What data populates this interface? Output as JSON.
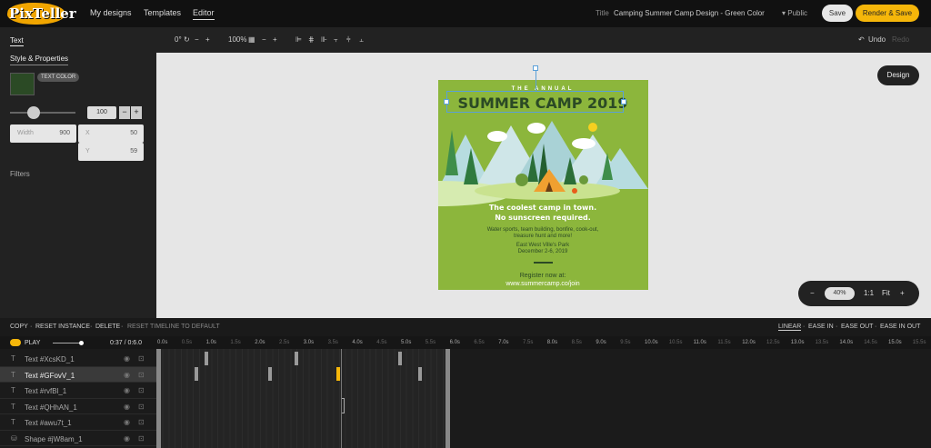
{
  "app": {
    "logo": "PixTeller",
    "nav": [
      "My designs",
      "Templates",
      "Editor"
    ]
  },
  "header": {
    "title_label": "Title",
    "title_value": "Camping Summer Camp Design - Green Color",
    "visibility": "▾ Public",
    "save": "Save",
    "render": "Render & Save"
  },
  "left": {
    "tab_text": "Text",
    "style_tab": "Style & Properties",
    "text_color_label": "TEXT COLOR",
    "text_color": "#2b4a25",
    "opacity_value": "100",
    "width_label": "Width",
    "width_value": "900",
    "x_label": "X",
    "x_value": "50",
    "y_label": "Y",
    "y_value": "59",
    "filters": "Filters"
  },
  "toolbar": {
    "rotation": "0°",
    "zoom_pct": "100%",
    "undo": "Undo",
    "redo": "Redo"
  },
  "canvas": {
    "design_btn": "Design",
    "zoom": "40%",
    "ratio": "1:1",
    "fit": "Fit",
    "poster_bg": "#8cb63c",
    "poster": {
      "kicker": "THE ANNUAL",
      "headline": "SUMMER CAMP 2019",
      "tag1": "The coolest camp in town.",
      "tag2": "No sunscreen required.",
      "desc1": "Water sports, team building, bonfire, cook-out,",
      "desc2": "treasure hunt and more!",
      "loc": "East West Ville's Park",
      "dates": "December 2-6, 2019",
      "reg": "Register now at:",
      "url": "www.summercamp.co/join"
    }
  },
  "actions": {
    "left": [
      "COPY",
      "·",
      "RESET INSTANCE",
      "·",
      "DELETE",
      "·",
      "RESET TIMELINE TO DEFAULT"
    ],
    "easing": [
      "LINEAR",
      "·",
      "EASE IN",
      "·",
      "EASE OUT",
      "·",
      "EASE IN OUT"
    ]
  },
  "timeline": {
    "play": "PLAY",
    "time": "0:37 / 0:6.0",
    "ticks": [
      "0.0s",
      "0.5s",
      "1.0s",
      "1.5s",
      "2.0s",
      "2.5s",
      "3.0s",
      "3.5s",
      "4.0s",
      "4.5s",
      "5.0s",
      "5.5s",
      "6.0s",
      "6.5s",
      "7.0s",
      "7.5s",
      "8.0s",
      "8.5s",
      "9.0s",
      "9.5s",
      "10.0s",
      "10.5s",
      "11.0s",
      "11.5s",
      "12.0s",
      "12.5s",
      "13.0s",
      "13.5s",
      "14.0s",
      "14.5s",
      "15.0s",
      "15.5s"
    ],
    "layers": [
      {
        "name": "Text #XcsKD_1"
      },
      {
        "name": "Text #GFovV_1"
      },
      {
        "name": "Text #rvfBl_1"
      },
      {
        "name": "Text #QHhAN_1"
      },
      {
        "name": "Text #awu7t_1"
      },
      {
        "name": "Shape #jW8am_1"
      }
    ]
  }
}
